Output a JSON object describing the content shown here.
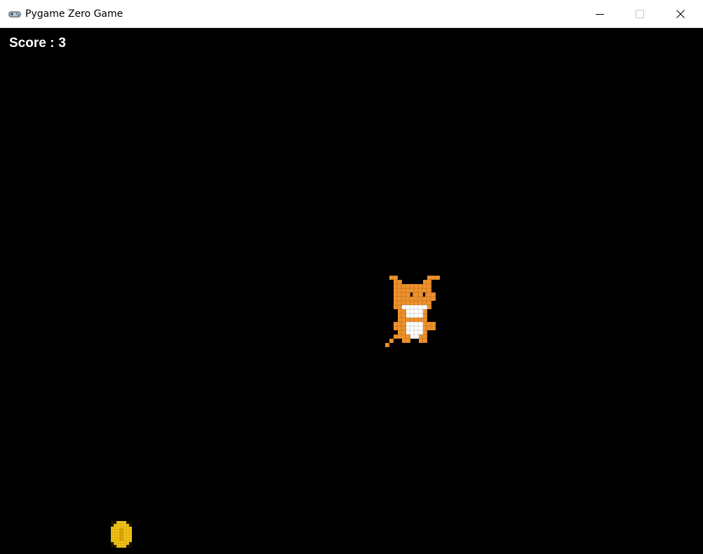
{
  "window": {
    "title": "Pygame Zero Game",
    "icon": "gamepad-icon",
    "controls": [
      "minimize-icon",
      "maximize-icon",
      "close-icon"
    ]
  },
  "hud": {
    "score_label": "Score :",
    "score_value": "3"
  },
  "sprites": {
    "player": {
      "name": "orange-pixel-cat",
      "color": "#f0922c",
      "belly_color": "#ffffff"
    },
    "coin": {
      "name": "gold-coin",
      "color": "#f5c518"
    }
  },
  "colors": {
    "background": "#000000",
    "titlebar": "#ffffff",
    "text": "#ffffff"
  }
}
